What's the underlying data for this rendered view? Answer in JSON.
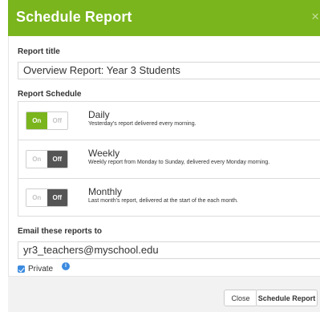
{
  "dialog": {
    "title": "Schedule Report",
    "close_glyph": "×"
  },
  "report_title": {
    "label": "Report title",
    "value": "Overview Report: Year 3 Students"
  },
  "schedule": {
    "label": "Report Schedule",
    "on_label": "On",
    "off_label": "Off",
    "rows": [
      {
        "title": "Daily",
        "description": "Yesterday's report delivered every morning.",
        "state": "on"
      },
      {
        "title": "Weekly",
        "description": "Weekly report from Monday to Sunday, delivered every Monday morning.",
        "state": "off"
      },
      {
        "title": "Monthly",
        "description": "Last month's report, delivered at the start of the each month.",
        "state": "off"
      }
    ]
  },
  "email": {
    "label": "Email these reports to",
    "value": "yr3_teachers@myschool.edu",
    "private_label": "Private",
    "private_checked": true,
    "info_glyph": "i"
  },
  "footer": {
    "close_label": "Close",
    "submit_label": "Schedule Report"
  },
  "colors": {
    "accent_green": "#7ab51d",
    "toggle_off_dark": "#555555",
    "checkbox_blue": "#3b8be0"
  }
}
